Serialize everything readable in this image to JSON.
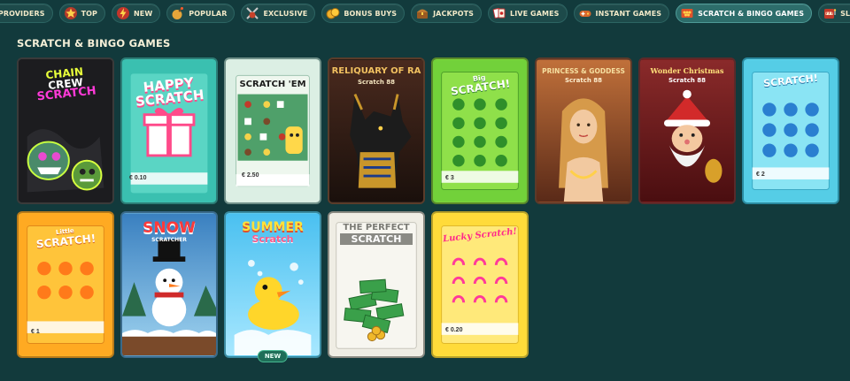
{
  "nav": {
    "items": [
      {
        "label": "PROVIDERS",
        "icon": "scroll-icon"
      },
      {
        "label": "TOP",
        "icon": "star-icon"
      },
      {
        "label": "NEW",
        "icon": "lightning-icon"
      },
      {
        "label": "POPULAR",
        "icon": "bomb-icon"
      },
      {
        "label": "EXCLUSIVE",
        "icon": "crossed-swords-icon"
      },
      {
        "label": "BONUS BUYS",
        "icon": "coins-icon"
      },
      {
        "label": "JACKPOTS",
        "icon": "treasure-chest-icon"
      },
      {
        "label": "LIVE GAMES",
        "icon": "playing-cards-icon"
      },
      {
        "label": "INSTANT GAMES",
        "icon": "gamepad-icon"
      },
      {
        "label": "SCRATCH & BINGO GAMES",
        "icon": "scratch-ticket-icon",
        "active": true
      },
      {
        "label": "SLOTS",
        "icon": "slot-machine-icon"
      }
    ]
  },
  "section": {
    "title": "SCRATCH & BINGO GAMES"
  },
  "games": [
    {
      "title_lines": [
        "CHAIN",
        "CREW",
        "SCRATCH"
      ],
      "theme": "chain-crew"
    },
    {
      "title_lines": [
        "HAPPY",
        "SCRATCH"
      ],
      "price": "€ 0.10",
      "theme": "happy"
    },
    {
      "title_lines": [
        "SCRATCH 'EM"
      ],
      "price": "€ 2.50",
      "theme": "scratchem"
    },
    {
      "title_lines": [
        "RELIQUARY OF RA",
        "Scratch 88"
      ],
      "theme": "ra"
    },
    {
      "title_lines": [
        "Big",
        "SCRATCH!"
      ],
      "price": "€ 3",
      "theme": "big"
    },
    {
      "title_lines": [
        "PRINCESS & GODDESS",
        "Scratch 88"
      ],
      "theme": "princess"
    },
    {
      "title_lines": [
        "Wonder Christmas",
        "Scratch 88"
      ],
      "theme": "christmas"
    },
    {
      "title_lines": [
        "SCRATCH!"
      ],
      "price": "€ 2",
      "theme": "blue"
    },
    {
      "title_lines": [
        "Little",
        "SCRATCH!"
      ],
      "price": "€ 1",
      "theme": "orange"
    },
    {
      "title_lines": [
        "SNOW",
        "SCRATCHER"
      ],
      "theme": "snow"
    },
    {
      "title_lines": [
        "SUMMER",
        "Scratch"
      ],
      "theme": "summer",
      "badge": "NEW"
    },
    {
      "title_lines": [
        "THE PERFECT",
        "SCRATCH"
      ],
      "theme": "perfect"
    },
    {
      "title_lines": [
        "Lucky Scratch!"
      ],
      "price": "€ 0.20",
      "theme": "lucky"
    }
  ]
}
